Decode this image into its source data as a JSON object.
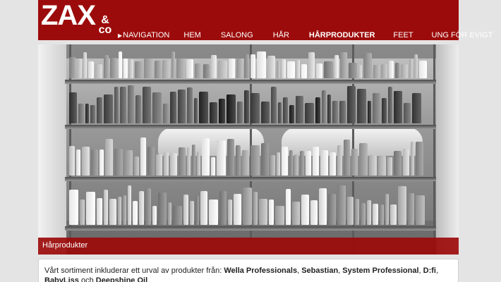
{
  "brand": {
    "logo_text": "ZAX",
    "logo_amp": "&",
    "logo_co": "co"
  },
  "nav": {
    "items": [
      {
        "label": "NAVIGATION",
        "name": "nav-item-navigation",
        "active": false,
        "arrow": true
      },
      {
        "label": "HEM",
        "name": "nav-item-hem",
        "active": false
      },
      {
        "label": "SALONG",
        "name": "nav-item-salong",
        "active": false
      },
      {
        "label": "HÅR",
        "name": "nav-item-har",
        "active": false
      },
      {
        "label": "HÅRPRODUKTER",
        "name": "nav-item-harprodukter",
        "active": true
      },
      {
        "label": "FEET",
        "name": "nav-item-feet",
        "active": false
      },
      {
        "label": "UNG FÖR EVIGT",
        "name": "nav-item-ung-for-evigt",
        "active": false
      }
    ]
  },
  "hero": {
    "caption": "Hårprodukter"
  },
  "content": {
    "intro": "Vårt sortiment inkluderar ett urval av produkter från: ",
    "brands": [
      "Wella Professionals",
      "Sebastian",
      "System Professional",
      "D:fi",
      "BabyLiss"
    ],
    "sep": ", ",
    "och": " och ",
    "last_brand": "Deepshine Oil"
  },
  "colors": {
    "brand_red": "#9c0b0b",
    "background": "#e4e4e4"
  },
  "icons": {
    "nav_arrow": "▶"
  }
}
